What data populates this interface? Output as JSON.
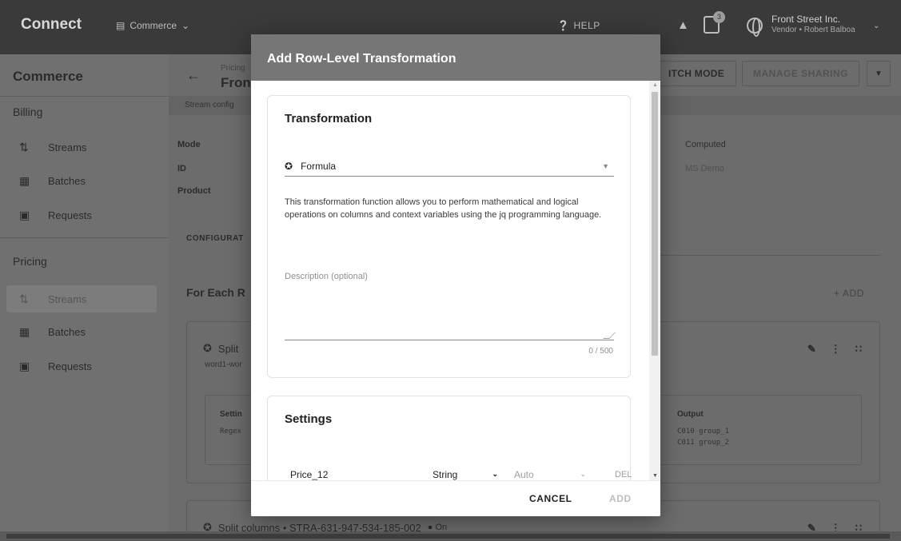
{
  "topbar": {
    "brand": "Connect",
    "module": "Commerce",
    "help": "HELP",
    "notif_count": "3",
    "account_name": "Front Street Inc.",
    "account_sub": "Vendor • Robert Balboa"
  },
  "sidebar": {
    "title": "Commerce",
    "billing": {
      "label": "Billing",
      "items": [
        {
          "label": "Streams",
          "icon": "streams-icon"
        },
        {
          "label": "Batches",
          "icon": "batches-icon"
        },
        {
          "label": "Requests",
          "icon": "requests-icon"
        }
      ]
    },
    "pricing": {
      "label": "Pricing",
      "items": [
        {
          "label": "Streams",
          "icon": "streams-icon",
          "active": true
        },
        {
          "label": "Batches",
          "icon": "batches-icon"
        },
        {
          "label": "Requests",
          "icon": "requests-icon"
        }
      ]
    }
  },
  "main": {
    "breadcrumb": "Pricing",
    "page_title": "Fron",
    "switch_mode": "ITCH MODE",
    "manage_sharing": "MANAGE SHARING",
    "strip_text": "Stream config",
    "labels": {
      "mode": "Mode",
      "id": "ID",
      "product": "Product"
    },
    "values": {
      "mode": "Computed",
      "product": "MS Demo"
    },
    "configuration": "CONFIGURAT",
    "for_each": "For Each R",
    "add": "+ ADD",
    "card1": {
      "title": "Split",
      "subtitle": "word1-wor",
      "settings_label": "Settin",
      "settings_code": "Regex",
      "output_label": "Output",
      "output_rows": [
        "C010  group_1",
        "C011  group_2"
      ]
    },
    "card2": {
      "title": "Split columns • STRA-631-947-534-185-002",
      "status": "● On"
    }
  },
  "modal": {
    "title": "Add Row-Level Transformation",
    "transformation": {
      "heading": "Transformation",
      "select_value": "Formula",
      "description": "This transformation function allows you to perform mathematical and logical operations on columns and context variables using the jq programming language.",
      "textarea_placeholder": "Description (optional)",
      "counter": "0 / 500"
    },
    "settings": {
      "heading": "Settings",
      "column_name": "Price_12",
      "type": "String",
      "auto": "Auto",
      "delete": "DEL"
    },
    "cancel": "CANCEL",
    "add": "ADD"
  }
}
